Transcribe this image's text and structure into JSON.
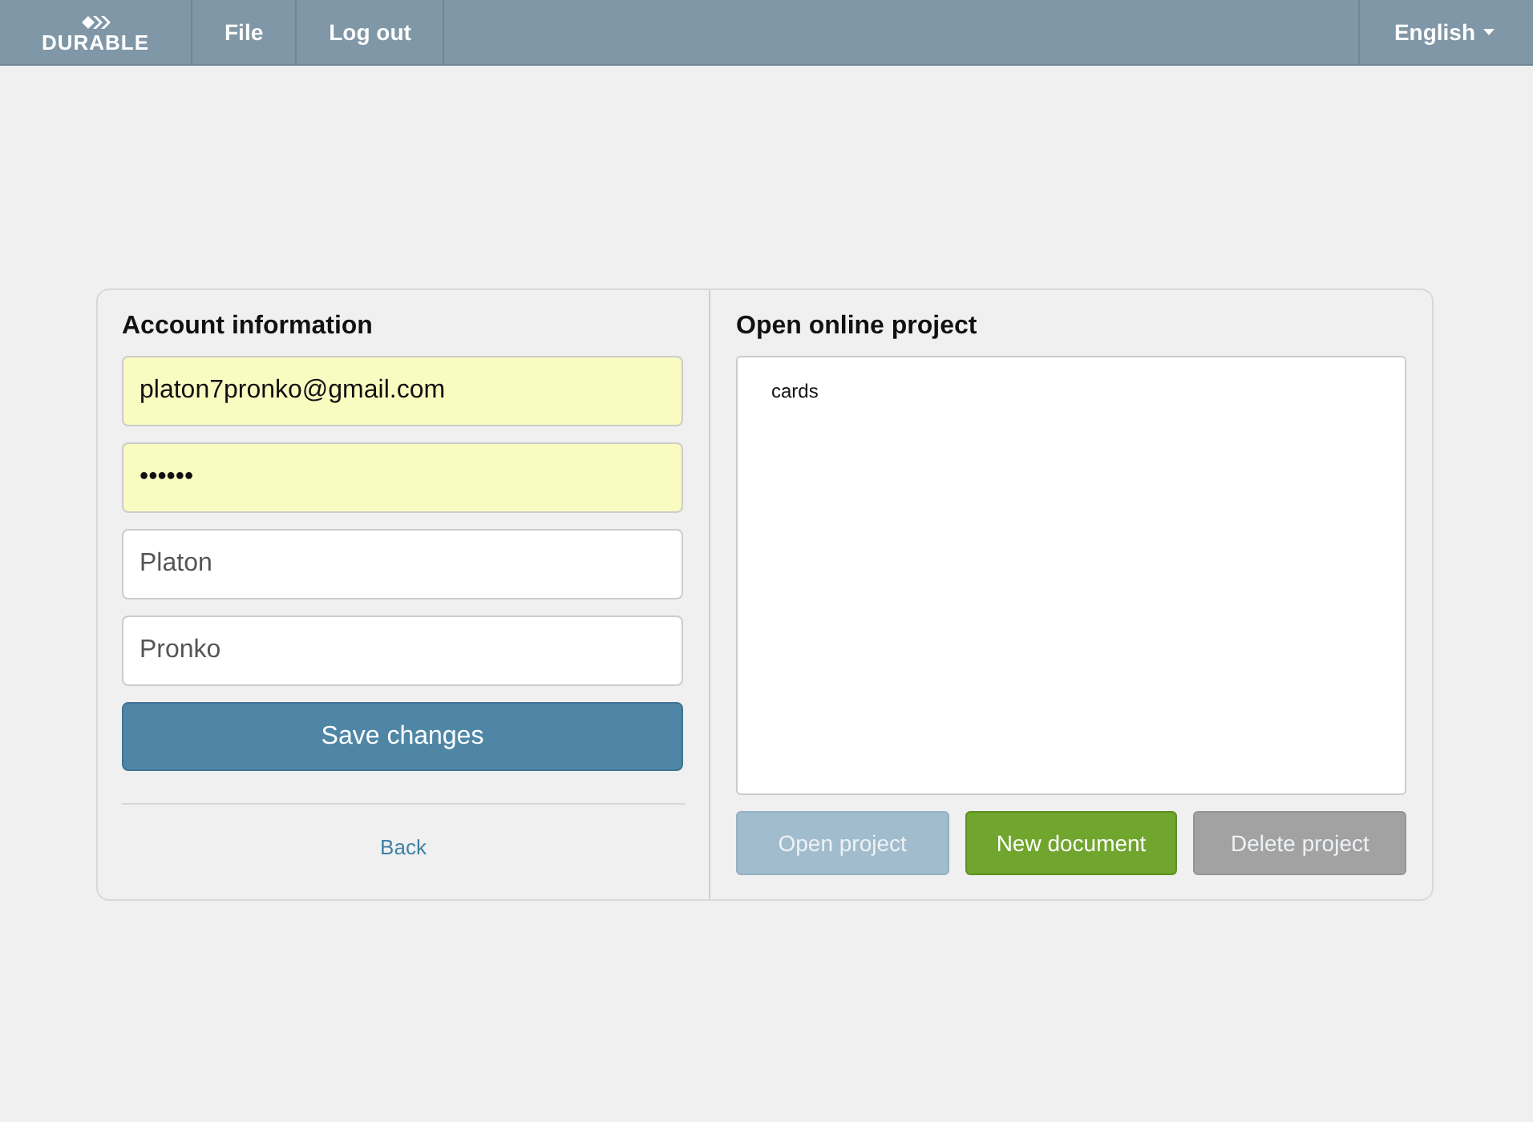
{
  "navbar": {
    "logo": "DURABLE",
    "menu": [
      {
        "label": "File"
      },
      {
        "label": "Log out"
      }
    ],
    "language": "English"
  },
  "account": {
    "title": "Account information",
    "fields": [
      {
        "value": "platon7pronko@gmail.com",
        "autofilled": true
      },
      {
        "value": "••••••",
        "autofilled": true
      },
      {
        "value": "Platon",
        "autofilled": false
      },
      {
        "value": "Pronko",
        "autofilled": false
      }
    ],
    "save_button": "Save changes",
    "back_link": "Back"
  },
  "projects": {
    "title": "Open online project",
    "items": [
      {
        "label": "cards",
        "selected": false
      }
    ],
    "buttons": [
      {
        "label": "Open project",
        "kind": "primary",
        "disabled": true
      },
      {
        "label": "New document",
        "kind": "success",
        "disabled": false
      },
      {
        "label": "Delete project",
        "kind": "default",
        "disabled": true
      }
    ]
  }
}
